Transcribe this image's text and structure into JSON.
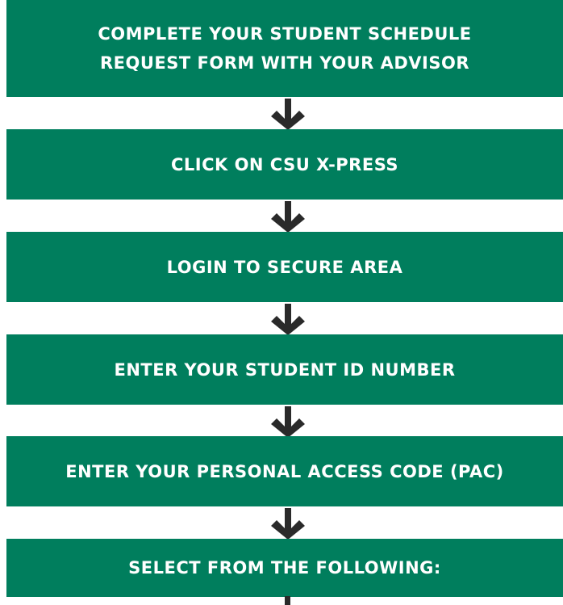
{
  "steps": [
    {
      "label": "COMPLETE YOUR STUDENT SCHEDULE\nREQUEST FORM WITH YOUR ADVISOR"
    },
    {
      "label": "CLICK ON CSU X-PRESS"
    },
    {
      "label": "LOGIN TO SECURE AREA"
    },
    {
      "label": "ENTER YOUR STUDENT ID NUMBER"
    },
    {
      "label": "ENTER YOUR PERSONAL ACCESS CODE (PAC)"
    },
    {
      "label": "SELECT FROM THE FOLLOWING:"
    }
  ],
  "colors": {
    "box": "#007e5d",
    "text": "#ffffff",
    "arrow": "#2a2a2a"
  },
  "icons": {
    "connector": "arrow-down-icon"
  }
}
